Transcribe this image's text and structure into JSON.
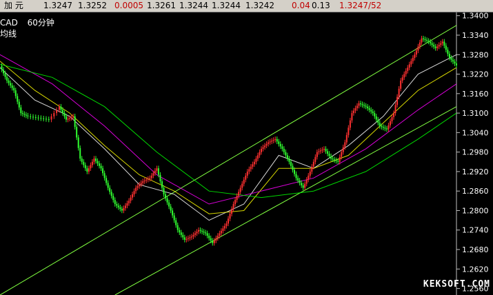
{
  "quote_bar": {
    "name": "加  元",
    "last": "1.3247",
    "ask": "1.3252",
    "change": "0.0005",
    "high": "1.3261",
    "low": "1.3244",
    "open": "1.3244",
    "prev": "1.3242",
    "pct": "0.04",
    "spread": "0.13",
    "vol": "1.3247/52"
  },
  "chart_header": {
    "symbol": "CAD",
    "period": "60分钟",
    "ma_label": "均线"
  },
  "watermark": "KEKSOFT.COM",
  "colors": {
    "up_candle": "#ff3030",
    "down_candle": "#30ff30",
    "ma5": "#ffffff",
    "ma10": "#ffff00",
    "ma20": "#ff00ff",
    "ma60": "#00ff00",
    "ma120": "#ffffff",
    "trendline": "#80ff40"
  },
  "chart_data": {
    "type": "line",
    "y_axis_ticks": [
      "1.3400",
      "1.3340",
      "1.3280",
      "1.3220",
      "1.3160",
      "1.3100",
      "1.3040",
      "1.2980",
      "1.2920",
      "1.2860",
      "1.2800",
      "1.2740",
      "1.2680",
      "1.2620",
      "1.2560"
    ],
    "ylim": [
      1.254,
      1.341
    ],
    "price_path": [
      [
        0,
        1.3245
      ],
      [
        4,
        1.32
      ],
      [
        8,
        1.317
      ],
      [
        12,
        1.31
      ],
      [
        16,
        1.309
      ],
      [
        22,
        1.3085
      ],
      [
        28,
        1.308
      ],
      [
        34,
        1.312
      ],
      [
        38,
        1.308
      ],
      [
        42,
        1.309
      ],
      [
        46,
        1.296
      ],
      [
        50,
        1.292
      ],
      [
        54,
        1.296
      ],
      [
        58,
        1.293
      ],
      [
        62,
        1.287
      ],
      [
        66,
        1.282
      ],
      [
        70,
        1.28
      ],
      [
        74,
        1.283
      ],
      [
        78,
        1.287
      ],
      [
        82,
        1.289
      ],
      [
        86,
        1.29
      ],
      [
        90,
        1.293
      ],
      [
        94,
        1.285
      ],
      [
        98,
        1.28
      ],
      [
        102,
        1.274
      ],
      [
        106,
        1.271
      ],
      [
        110,
        1.272
      ],
      [
        114,
        1.274
      ],
      [
        118,
        1.273
      ],
      [
        122,
        1.27
      ],
      [
        126,
        1.273
      ],
      [
        130,
        1.276
      ],
      [
        134,
        1.282
      ],
      [
        138,
        1.287
      ],
      [
        142,
        1.292
      ],
      [
        146,
        1.295
      ],
      [
        150,
        1.299
      ],
      [
        154,
        1.301
      ],
      [
        158,
        1.302
      ],
      [
        162,
        1.299
      ],
      [
        166,
        1.295
      ],
      [
        170,
        1.29
      ],
      [
        174,
        1.287
      ],
      [
        178,
        1.292
      ],
      [
        182,
        1.298
      ],
      [
        186,
        1.299
      ],
      [
        190,
        1.296
      ],
      [
        194,
        1.295
      ],
      [
        198,
        1.301
      ],
      [
        202,
        1.31
      ],
      [
        206,
        1.313
      ],
      [
        210,
        1.312
      ],
      [
        214,
        1.31
      ],
      [
        218,
        1.306
      ],
      [
        222,
        1.305
      ],
      [
        226,
        1.31
      ],
      [
        230,
        1.32
      ],
      [
        234,
        1.324
      ],
      [
        238,
        1.328
      ],
      [
        242,
        1.333
      ],
      [
        246,
        1.332
      ],
      [
        250,
        1.33
      ],
      [
        254,
        1.332
      ],
      [
        258,
        1.327
      ],
      [
        262,
        1.3247
      ]
    ],
    "ma_series": [
      {
        "values": [
          [
            0,
            1.324
          ],
          [
            20,
            1.314
          ],
          [
            40,
            1.309
          ],
          [
            60,
            1.299
          ],
          [
            80,
            1.288
          ],
          [
            100,
            1.285
          ],
          [
            120,
            1.277
          ],
          [
            140,
            1.282
          ],
          [
            160,
            1.297
          ],
          [
            180,
            1.293
          ],
          [
            200,
            1.3
          ],
          [
            220,
            1.309
          ],
          [
            240,
            1.322
          ],
          [
            262,
            1.328
          ]
        ]
      },
      {
        "values": [
          [
            0,
            1.326
          ],
          [
            20,
            1.317
          ],
          [
            40,
            1.31
          ],
          [
            60,
            1.3
          ],
          [
            80,
            1.291
          ],
          [
            100,
            1.286
          ],
          [
            120,
            1.279
          ],
          [
            140,
            1.28
          ],
          [
            160,
            1.293
          ],
          [
            180,
            1.293
          ],
          [
            200,
            1.297
          ],
          [
            220,
            1.307
          ],
          [
            240,
            1.317
          ],
          [
            262,
            1.324
          ]
        ]
      },
      {
        "values": [
          [
            0,
            1.328
          ],
          [
            30,
            1.319
          ],
          [
            60,
            1.306
          ],
          [
            90,
            1.291
          ],
          [
            120,
            1.282
          ],
          [
            150,
            1.286
          ],
          [
            180,
            1.29
          ],
          [
            210,
            1.299
          ],
          [
            240,
            1.311
          ],
          [
            262,
            1.319
          ]
        ]
      },
      {
        "values": [
          [
            0,
            1.325
          ],
          [
            30,
            1.321
          ],
          [
            60,
            1.312
          ],
          [
            90,
            1.298
          ],
          [
            120,
            1.286
          ],
          [
            150,
            1.284
          ],
          [
            180,
            1.286
          ],
          [
            210,
            1.292
          ],
          [
            240,
            1.302
          ],
          [
            262,
            1.31
          ]
        ]
      }
    ],
    "channel": [
      {
        "from": [
          0,
          1.254
        ],
        "to": [
          262,
          1.337
        ]
      },
      {
        "from": [
          66,
          1.254
        ],
        "to": [
          262,
          1.312
        ]
      }
    ]
  }
}
